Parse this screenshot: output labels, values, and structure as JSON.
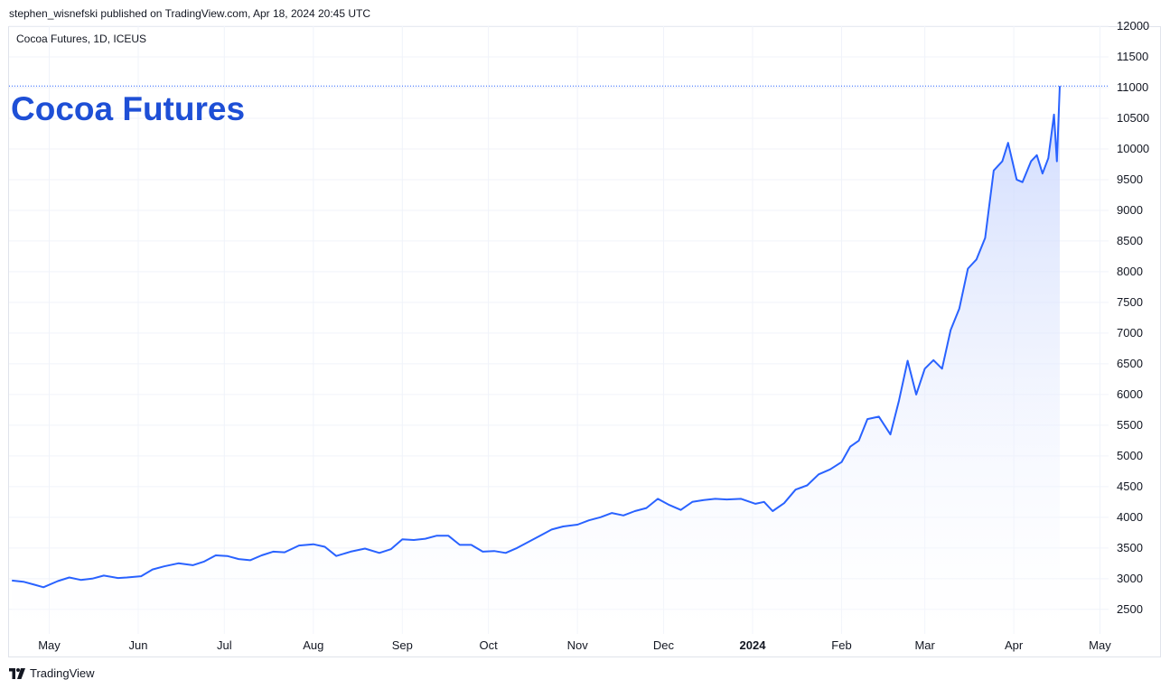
{
  "header": {
    "publisher_line": "stephen_wisnefski published on TradingView.com, Apr 18, 2024 20:45 UTC"
  },
  "footer": {
    "brand": "TradingView"
  },
  "colors": {
    "line": "#2962ff",
    "fill_top": "#c5d3fd",
    "fill_bottom": "#ffffff",
    "title": "#1e4fd6",
    "grid": "#f0f3fa",
    "text": "#131722"
  },
  "chart_data": {
    "type": "area",
    "symbol_label": "Cocoa Futures, 1D, ICEUS",
    "title": "Cocoa Futures",
    "ylim": [
      2100,
      12000
    ],
    "y_ticks": [
      2500,
      3000,
      3500,
      4000,
      4500,
      5000,
      5500,
      6000,
      6500,
      7000,
      7500,
      8000,
      8500,
      9000,
      9500,
      10000,
      10500,
      11000,
      11500,
      12000
    ],
    "x_ticks": [
      {
        "label": "May",
        "date": "2023-05-01",
        "bold": false
      },
      {
        "label": "Jun",
        "date": "2023-06-01",
        "bold": false
      },
      {
        "label": "Jul",
        "date": "2023-07-01",
        "bold": false
      },
      {
        "label": "Aug",
        "date": "2023-08-01",
        "bold": false
      },
      {
        "label": "Sep",
        "date": "2023-09-01",
        "bold": false
      },
      {
        "label": "Oct",
        "date": "2023-10-01",
        "bold": false
      },
      {
        "label": "Nov",
        "date": "2023-11-01",
        "bold": false
      },
      {
        "label": "Dec",
        "date": "2023-12-01",
        "bold": false
      },
      {
        "label": "2024",
        "date": "2024-01-01",
        "bold": true
      },
      {
        "label": "Feb",
        "date": "2024-02-01",
        "bold": false
      },
      {
        "label": "Mar",
        "date": "2024-03-01",
        "bold": false
      },
      {
        "label": "Apr",
        "date": "2024-04-01",
        "bold": false
      },
      {
        "label": "May",
        "date": "2024-05-01",
        "bold": false
      }
    ],
    "x_range": [
      "2023-04-17",
      "2024-05-04"
    ],
    "last_value": 11025,
    "grid": true,
    "series": [
      {
        "x": [
          "2023-04-18",
          "2023-04-22",
          "2023-04-26",
          "2023-04-29",
          "2023-05-04",
          "2023-05-08",
          "2023-05-12",
          "2023-05-16",
          "2023-05-20",
          "2023-05-25",
          "2023-05-28",
          "2023-06-02",
          "2023-06-06",
          "2023-06-10",
          "2023-06-15",
          "2023-06-20",
          "2023-06-24",
          "2023-06-28",
          "2023-07-02",
          "2023-07-06",
          "2023-07-10",
          "2023-07-14",
          "2023-07-18",
          "2023-07-22",
          "2023-07-27",
          "2023-08-01",
          "2023-08-05",
          "2023-08-09",
          "2023-08-14",
          "2023-08-19",
          "2023-08-24",
          "2023-08-28",
          "2023-09-01",
          "2023-09-05",
          "2023-09-09",
          "2023-09-13",
          "2023-09-17",
          "2023-09-21",
          "2023-09-25",
          "2023-09-29",
          "2023-10-03",
          "2023-10-07",
          "2023-10-11",
          "2023-10-15",
          "2023-10-19",
          "2023-10-23",
          "2023-10-27",
          "2023-11-01",
          "2023-11-05",
          "2023-11-09",
          "2023-11-13",
          "2023-11-17",
          "2023-11-21",
          "2023-11-25",
          "2023-11-29",
          "2023-12-03",
          "2023-12-07",
          "2023-12-11",
          "2023-12-15",
          "2023-12-19",
          "2023-12-23",
          "2023-12-28",
          "2024-01-02",
          "2024-01-05",
          "2024-01-08",
          "2024-01-12",
          "2024-01-16",
          "2024-01-20",
          "2024-01-24",
          "2024-01-28",
          "2024-02-01",
          "2024-02-04",
          "2024-02-07",
          "2024-02-10",
          "2024-02-14",
          "2024-02-18",
          "2024-02-21",
          "2024-02-24",
          "2024-02-27",
          "2024-03-01",
          "2024-03-04",
          "2024-03-07",
          "2024-03-10",
          "2024-03-13",
          "2024-03-16",
          "2024-03-19",
          "2024-03-22",
          "2024-03-25",
          "2024-03-28",
          "2024-03-30",
          "2024-04-02",
          "2024-04-04",
          "2024-04-07",
          "2024-04-09",
          "2024-04-11",
          "2024-04-13",
          "2024-04-15",
          "2024-04-16",
          "2024-04-17"
        ],
        "values": [
          2970,
          2950,
          2900,
          2860,
          2960,
          3020,
          2980,
          3000,
          3050,
          3010,
          3020,
          3040,
          3150,
          3200,
          3250,
          3220,
          3280,
          3380,
          3370,
          3320,
          3300,
          3380,
          3440,
          3430,
          3540,
          3560,
          3520,
          3370,
          3440,
          3490,
          3420,
          3480,
          3640,
          3630,
          3650,
          3700,
          3700,
          3550,
          3550,
          3440,
          3450,
          3420,
          3500,
          3600,
          3700,
          3800,
          3850,
          3880,
          3950,
          4000,
          4070,
          4030,
          4100,
          4150,
          4300,
          4200,
          4120,
          4250,
          4280,
          4300,
          4290,
          4300,
          4220,
          4250,
          4100,
          4230,
          4450,
          4520,
          4700,
          4780,
          4900,
          5150,
          5250,
          5600,
          5640,
          5350,
          5900,
          6550,
          6000,
          6420,
          6560,
          6420,
          7050,
          7400,
          8050,
          8200,
          8550,
          9650,
          9800,
          10100,
          9500,
          9460,
          9800,
          9900,
          9600,
          9850,
          10560,
          9800,
          11025
        ]
      }
    ]
  }
}
